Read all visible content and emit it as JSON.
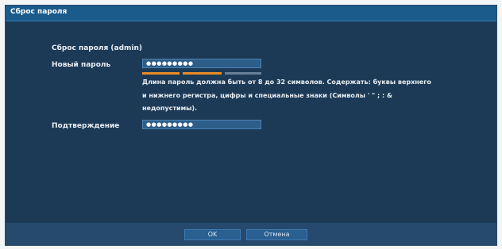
{
  "dialog": {
    "title": "Сброс пароля",
    "heading": "Сброс пароля (admin)"
  },
  "form": {
    "new_password_label": "Новый пароль",
    "new_password_value": "●●●●●●●●●",
    "strength_colors": [
      "#e98c26",
      "#e98c26",
      "#6a8099"
    ],
    "hint": "Длина пароль должна быть от 8 до 32 символов. Содержать: буквы верхнего и нижнего регистра, цифры и специальные знаки (Символы ' \" ; : & недопустимы).",
    "confirm_label": "Подтверждение",
    "confirm_value": "●●●●●●●●●"
  },
  "buttons": {
    "ok_label": "OK",
    "cancel_label": "Отмена"
  }
}
